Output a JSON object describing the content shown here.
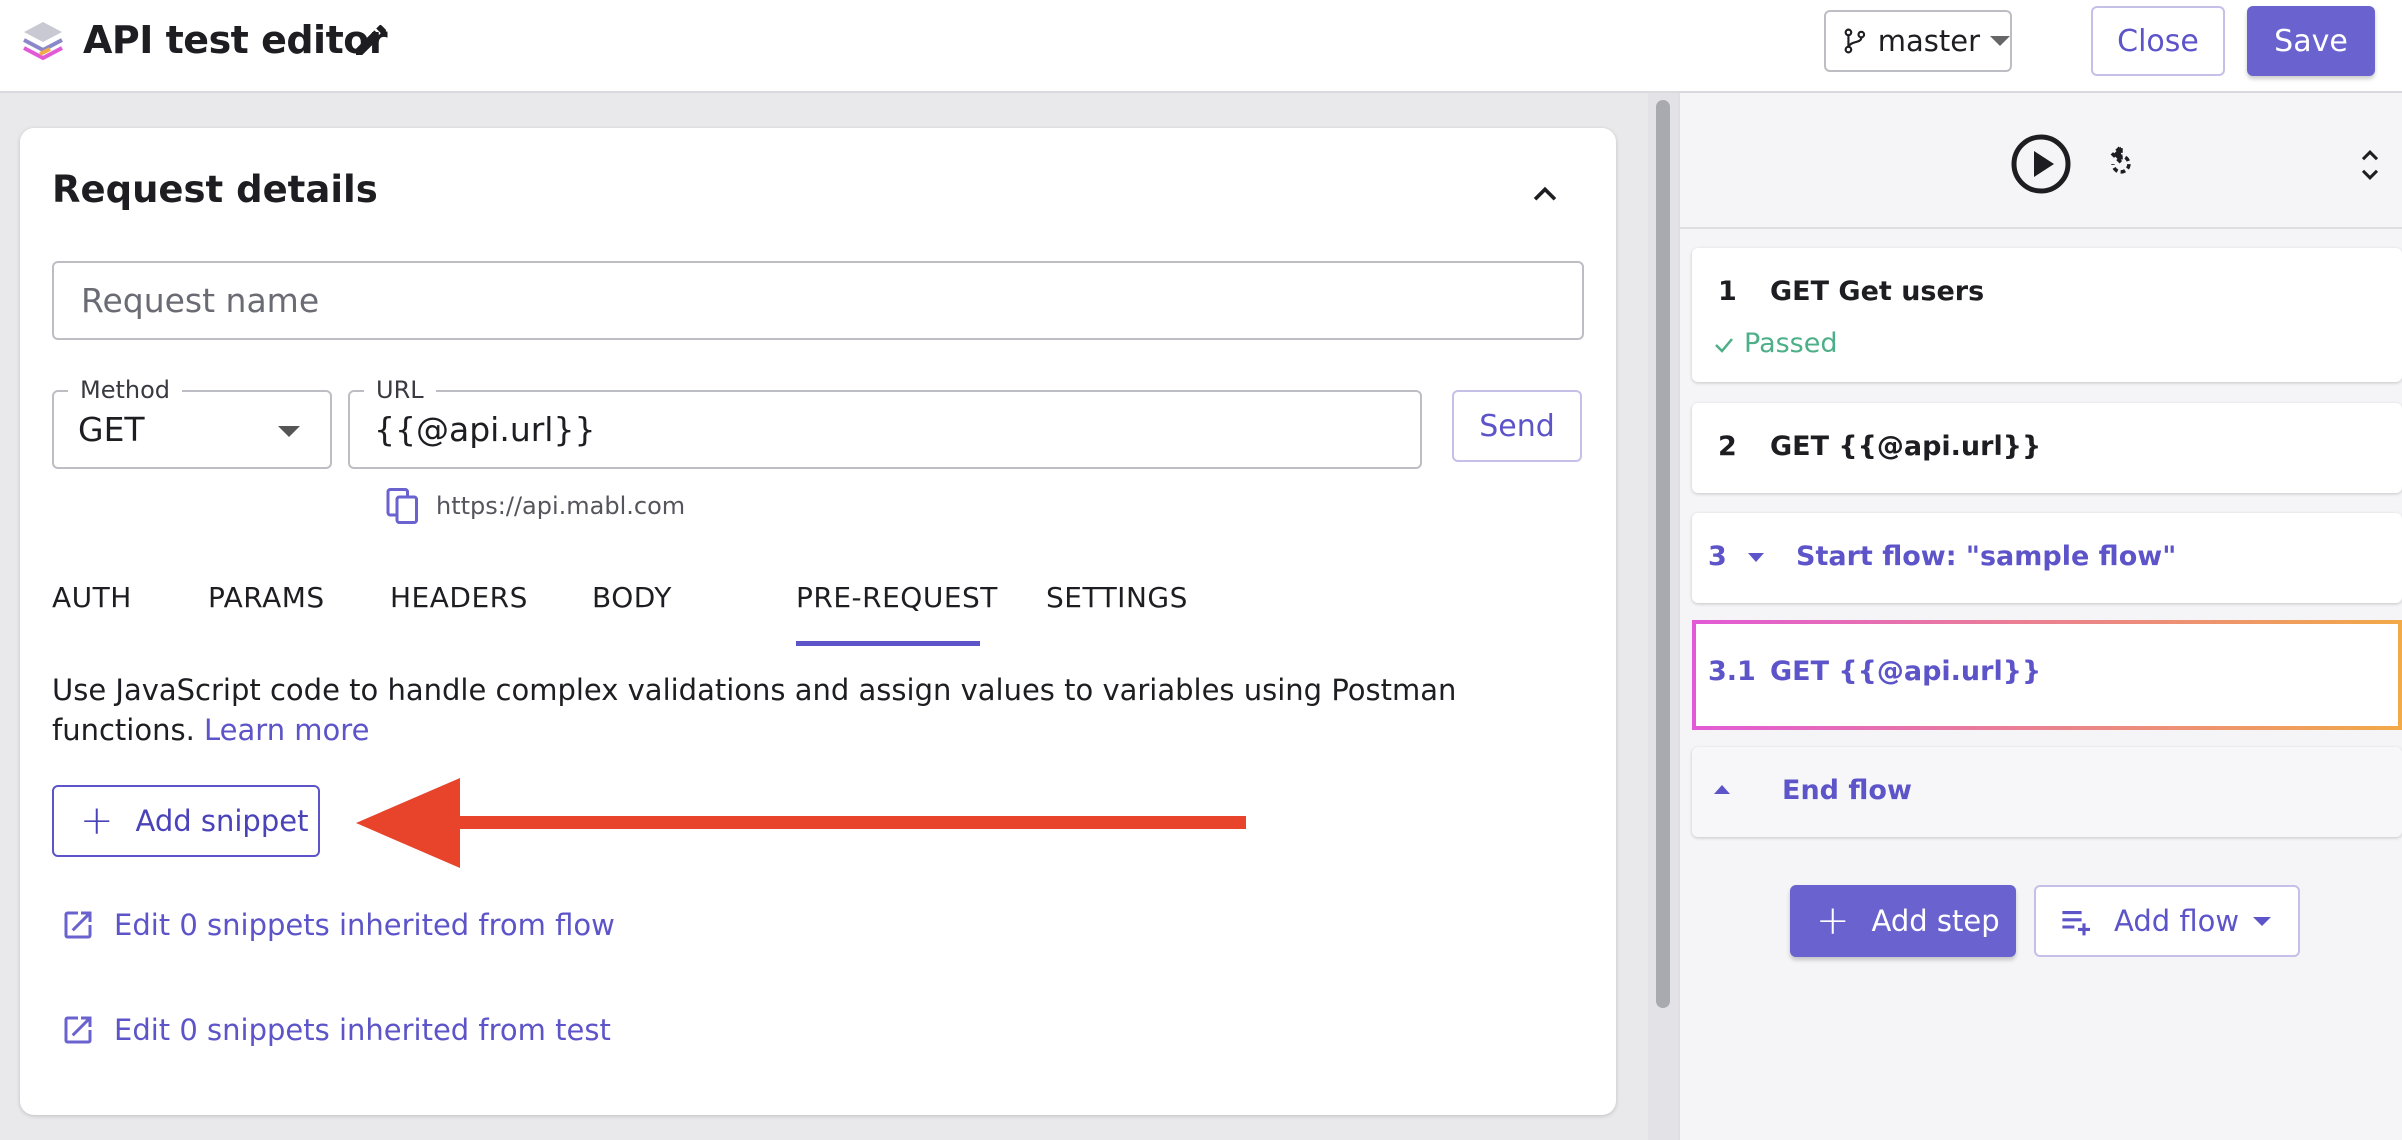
{
  "header": {
    "title": "API test editor",
    "branch": "master",
    "close_label": "Close",
    "save_label": "Save"
  },
  "request": {
    "section_title": "Request details",
    "name_placeholder": "Request name",
    "method_label": "Method",
    "method_value": "GET",
    "url_label": "URL",
    "url_value": "{{@api.url}}",
    "send_label": "Send",
    "resolved_url": "https://api.mabl.com"
  },
  "tabs": [
    "AUTH",
    "PARAMS",
    "HEADERS",
    "BODY",
    "PRE-REQUEST",
    "SETTINGS"
  ],
  "active_tab": "PRE-REQUEST",
  "pre_request": {
    "description": "Use JavaScript code to handle complex validations and assign values to variables using Postman functions.",
    "learn_more": "Learn more",
    "add_snippet_label": "Add snippet",
    "inherit_flow_label": "Edit 0 snippets inherited from flow",
    "inherit_test_label": "Edit 0 snippets inherited from test"
  },
  "steps": [
    {
      "num": "1",
      "text": "GET Get users",
      "status": "Passed"
    },
    {
      "num": "2",
      "text": "GET {{@api.url}}"
    },
    {
      "num": "3",
      "text": "Start flow: \"sample flow\""
    },
    {
      "num": "3.1",
      "text": "GET {{@api.url}}"
    },
    {
      "text": "End flow"
    }
  ],
  "actions": {
    "add_step_label": "Add step",
    "add_flow_label": "Add flow"
  },
  "colors": {
    "accent": "#5c54c8",
    "primary_button": "#6a63cf",
    "passed": "#4caf88",
    "annotation_arrow": "#e8432b",
    "selected_gradient_start": "#e25ad6",
    "selected_gradient_end": "#f2a947"
  }
}
